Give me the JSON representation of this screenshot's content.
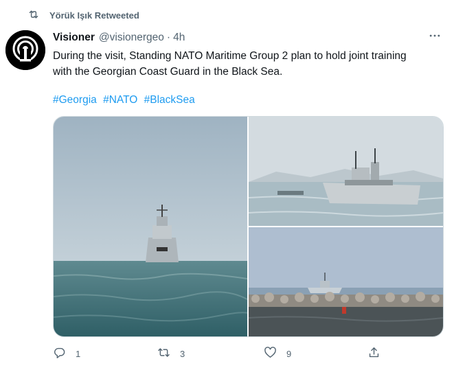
{
  "social_context": {
    "text": "Yörük Işık Retweeted",
    "icon": "retweet-icon"
  },
  "tweet": {
    "author_name": "Visioner",
    "handle": "@visionergeo",
    "separator": "·",
    "time": "4h",
    "text": "During the visit, Standing NATO Maritime Group 2 plan to hold joint training\nwith the Georgian Coast Guard in the Black Sea.",
    "hashtags": [
      "#Georgia",
      "#NATO",
      "#BlackSea"
    ],
    "media_count": 3
  },
  "actions": {
    "reply_count": "1",
    "retweet_count": "3",
    "like_count": "9",
    "reply_icon": "reply-icon",
    "retweet_icon": "retweet-icon",
    "like_icon": "heart-icon",
    "share_icon": "share-icon"
  },
  "colors": {
    "accent": "#1d9bf0",
    "secondary_text": "#536471",
    "border": "#cfd9de"
  }
}
